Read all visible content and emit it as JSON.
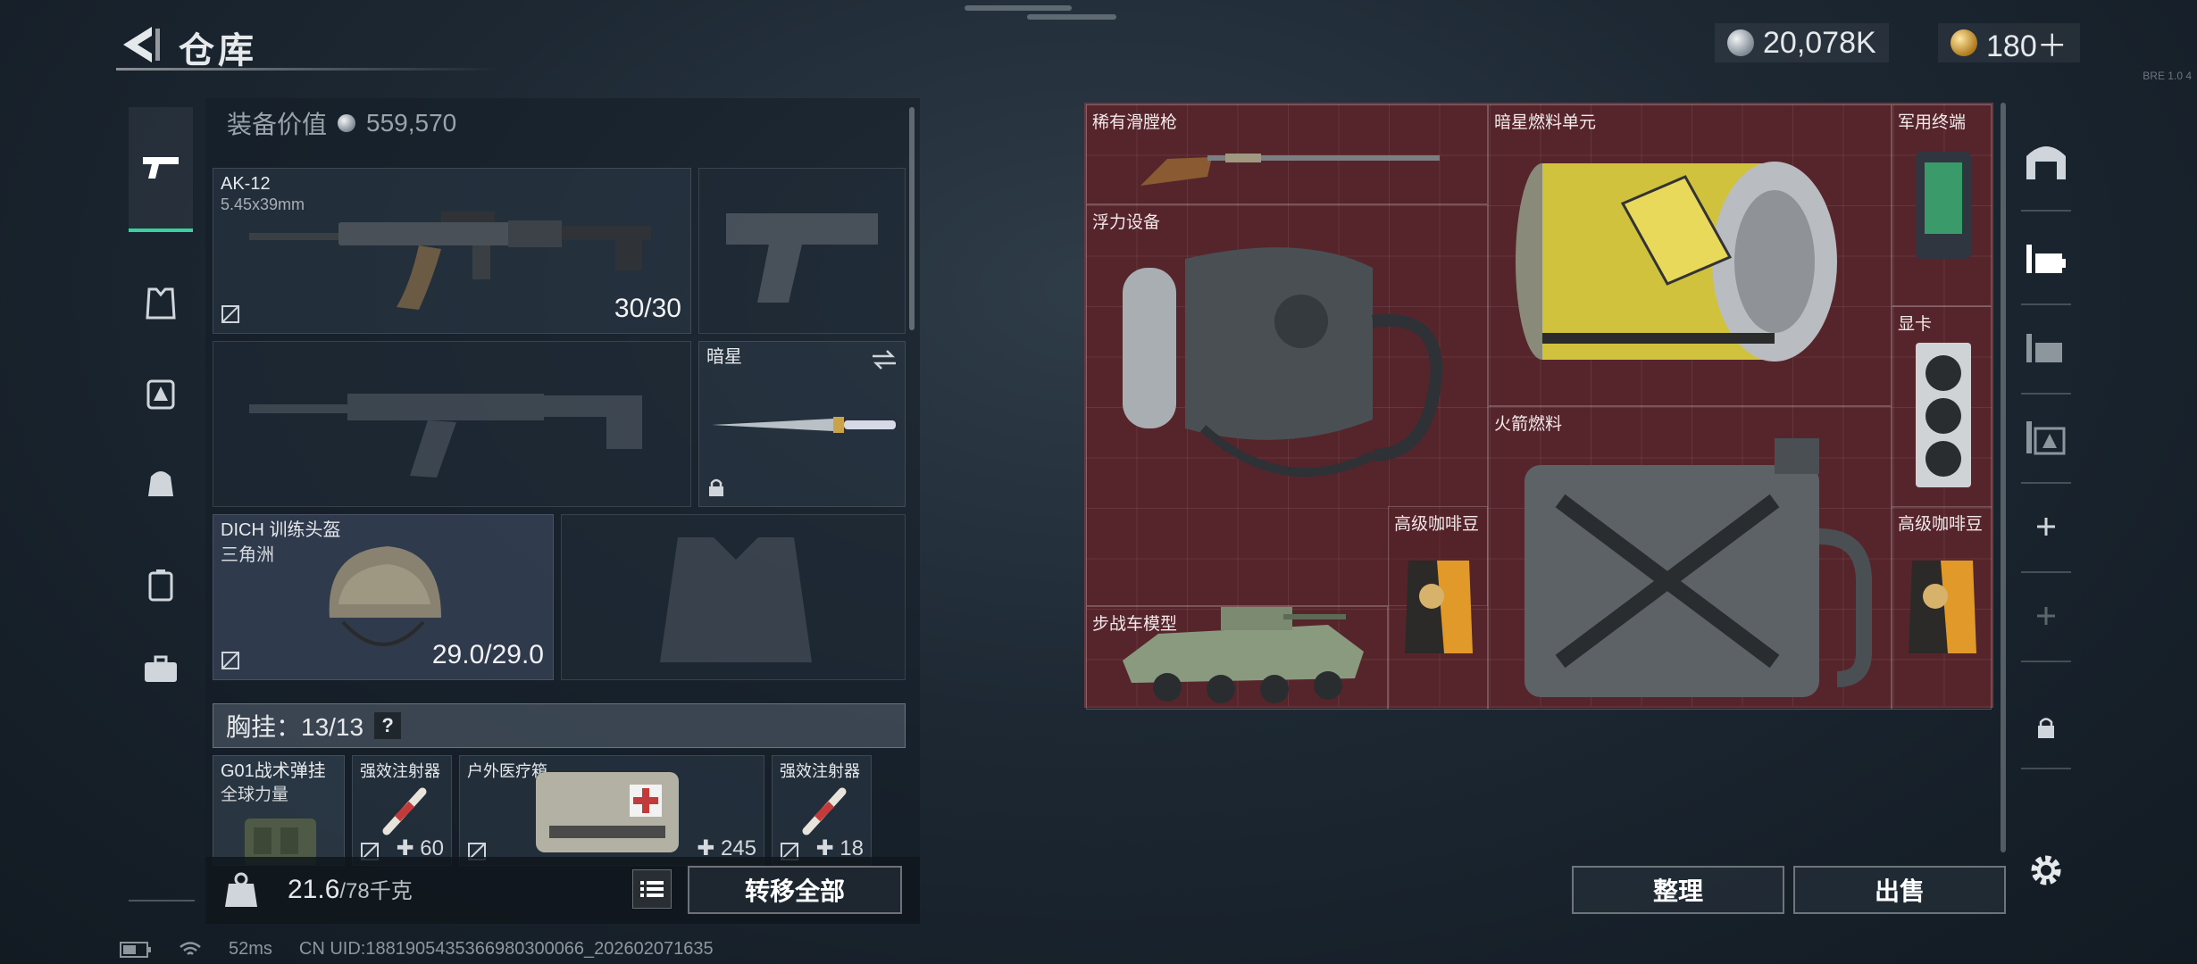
{
  "header": {
    "title": "仓库",
    "currency_silver": "20,078K",
    "currency_gold": "180＋",
    "build_code": "BRE 1.0 4"
  },
  "equipment": {
    "value_label": "装备价值",
    "value": "559,570",
    "primary_weapon": {
      "name": "AK-12",
      "caliber": "5.45x39mm",
      "ammo": "30/30"
    },
    "melee": {
      "name": "暗星"
    },
    "helmet": {
      "name": "DICH 训练头盔",
      "sub": "三角洲",
      "durability": "29.0/29.0"
    },
    "chest_rig": {
      "label": "胸挂：13/13",
      "help": "?"
    },
    "rig_items": [
      {
        "name": "G01战术弹挂",
        "sub": "全球力量",
        "count": ""
      },
      {
        "name": "强效注射器",
        "count": "60"
      },
      {
        "name": "户外医疗箱",
        "count": "245"
      },
      {
        "name": "强效注射器",
        "count": "18"
      }
    ]
  },
  "bottom_bar": {
    "weight_current": "21.6",
    "weight_max": "/78千克",
    "transfer_all": "转移全部"
  },
  "container": {
    "items": [
      {
        "name": "稀有滑膛枪"
      },
      {
        "name": "暗星燃料单元"
      },
      {
        "name": "军用终端"
      },
      {
        "name": "浮力设备"
      },
      {
        "name": "显卡"
      },
      {
        "name": "火箭燃料"
      },
      {
        "name": "步战车模型"
      },
      {
        "name": "高级咖啡豆"
      },
      {
        "name": "高级咖啡豆"
      }
    ],
    "sort_button": "整理",
    "sell_button": "出售"
  },
  "status_bar": {
    "ping": "52ms",
    "uid": "CN UID:1881905435366980300066_202602071635"
  },
  "colors": {
    "container_bg": "#5a2a31",
    "accent": "#3ad0a0"
  }
}
